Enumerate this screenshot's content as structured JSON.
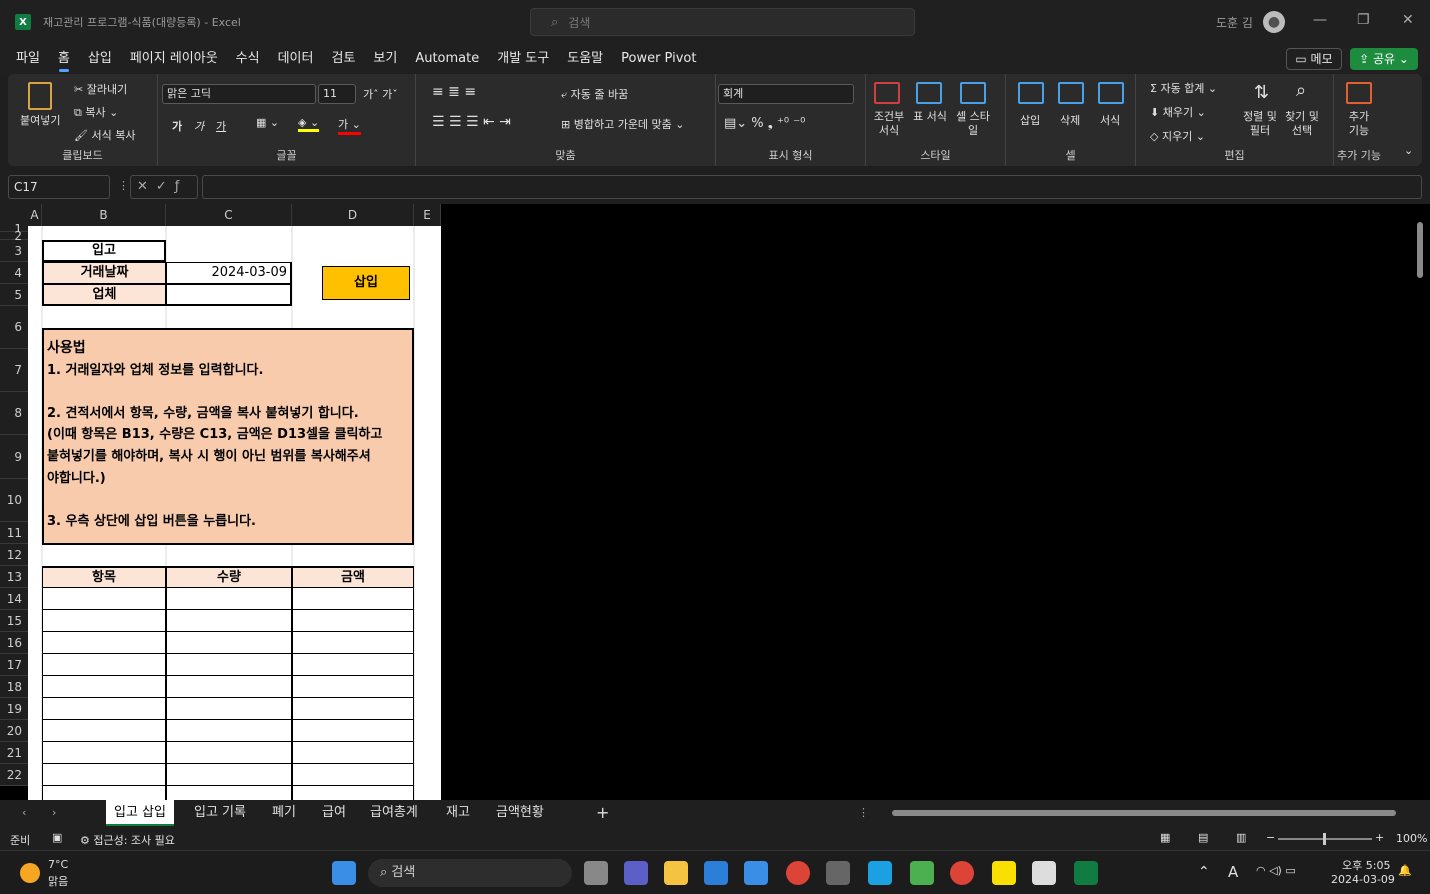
{
  "window": {
    "title": "재고관리 프로그램-식품(대량등록)  -  Excel",
    "search_placeholder": "검색",
    "user": "도훈 김"
  },
  "menu": [
    "파일",
    "홈",
    "삽입",
    "페이지 레이아웃",
    "수식",
    "데이터",
    "검토",
    "보기",
    "Automate",
    "개발 도구",
    "도움말",
    "Power Pivot"
  ],
  "menu_active": "홈",
  "actions": {
    "memo": "메모",
    "share": "공유"
  },
  "ribbon": {
    "clipboard": {
      "paste": "붙여넣기",
      "cut": "잘라내기",
      "copy": "복사",
      "format_painter": "서식 복사",
      "label": "클립보드"
    },
    "font": {
      "name": "맑은 고딕",
      "size": "11",
      "bold": "가",
      "italic": "가",
      "underline": "가",
      "label": "글꼴"
    },
    "alignment": {
      "wrap": "자동 줄 바꿈",
      "merge": "병합하고 가운데 맞춤",
      "label": "맞춤"
    },
    "number": {
      "format": "회계",
      "label": "표시 형식"
    },
    "styles": {
      "conditional": "조건부 서식",
      "table": "표 서식",
      "cell": "셀 스타일",
      "label": "스타일"
    },
    "cells": {
      "insert": "삽입",
      "delete": "삭제",
      "format": "서식",
      "label": "셀"
    },
    "editing": {
      "autosum": "자동 합계",
      "fill": "채우기",
      "clear": "지우기",
      "sort": "정렬 및 필터",
      "find": "찾기 및 선택",
      "label": "편집"
    },
    "addins": {
      "button": "추가 기능",
      "label": "추가 기능"
    }
  },
  "formula": {
    "namebox": "C17",
    "value": ""
  },
  "columns": [
    "A",
    "B",
    "C",
    "D",
    "E"
  ],
  "rows": [
    "1",
    "2",
    "3",
    "4",
    "5",
    "6",
    "7",
    "8",
    "9",
    "10",
    "11",
    "12",
    "13",
    "14",
    "15",
    "16",
    "17",
    "18",
    "19",
    "20",
    "21",
    "22"
  ],
  "sheet": {
    "header": "입고",
    "date_label": "거래날짜",
    "date_value": "2024-03-09",
    "vendor_label": "업체",
    "insert_button": "삽입",
    "usage_title": "사용법",
    "usage_lines": [
      "1. 거래일자와 업체 정보를 입력합니다.",
      "",
      "2. 견적서에서 항목, 수량, 금액을 복사 붙혀넣기 합니다.",
      "(이때 항목은 B13, 수량은 C13, 금액은 D13셀을 클릭하고",
      "붙혀넣기를 해야하며, 복사 시 행이 아닌 범위를 복사해주셔",
      "야합니다.)",
      "",
      "3. 우측 상단에 삽입 버튼을 누릅니다."
    ],
    "table_headers": [
      "항목",
      "수량",
      "금액"
    ]
  },
  "tabs": [
    "입고 삽입",
    "입고 기록",
    "폐기",
    "급여",
    "급여총계",
    "재고",
    "금액현황"
  ],
  "active_tab": "입고 삽입",
  "status": {
    "ready": "준비",
    "accessibility": "접근성: 조사 필요",
    "zoom": "100%"
  },
  "taskbar": {
    "temp": "7°C",
    "weather": "맑음",
    "search": "검색",
    "time": "오후 5:05",
    "date": "2024-03-09"
  },
  "colors": {
    "accent": "#107c41",
    "usage_fill": "#f8cbad",
    "button_fill": "#ffc000",
    "header_fill": "#fce4d6"
  }
}
